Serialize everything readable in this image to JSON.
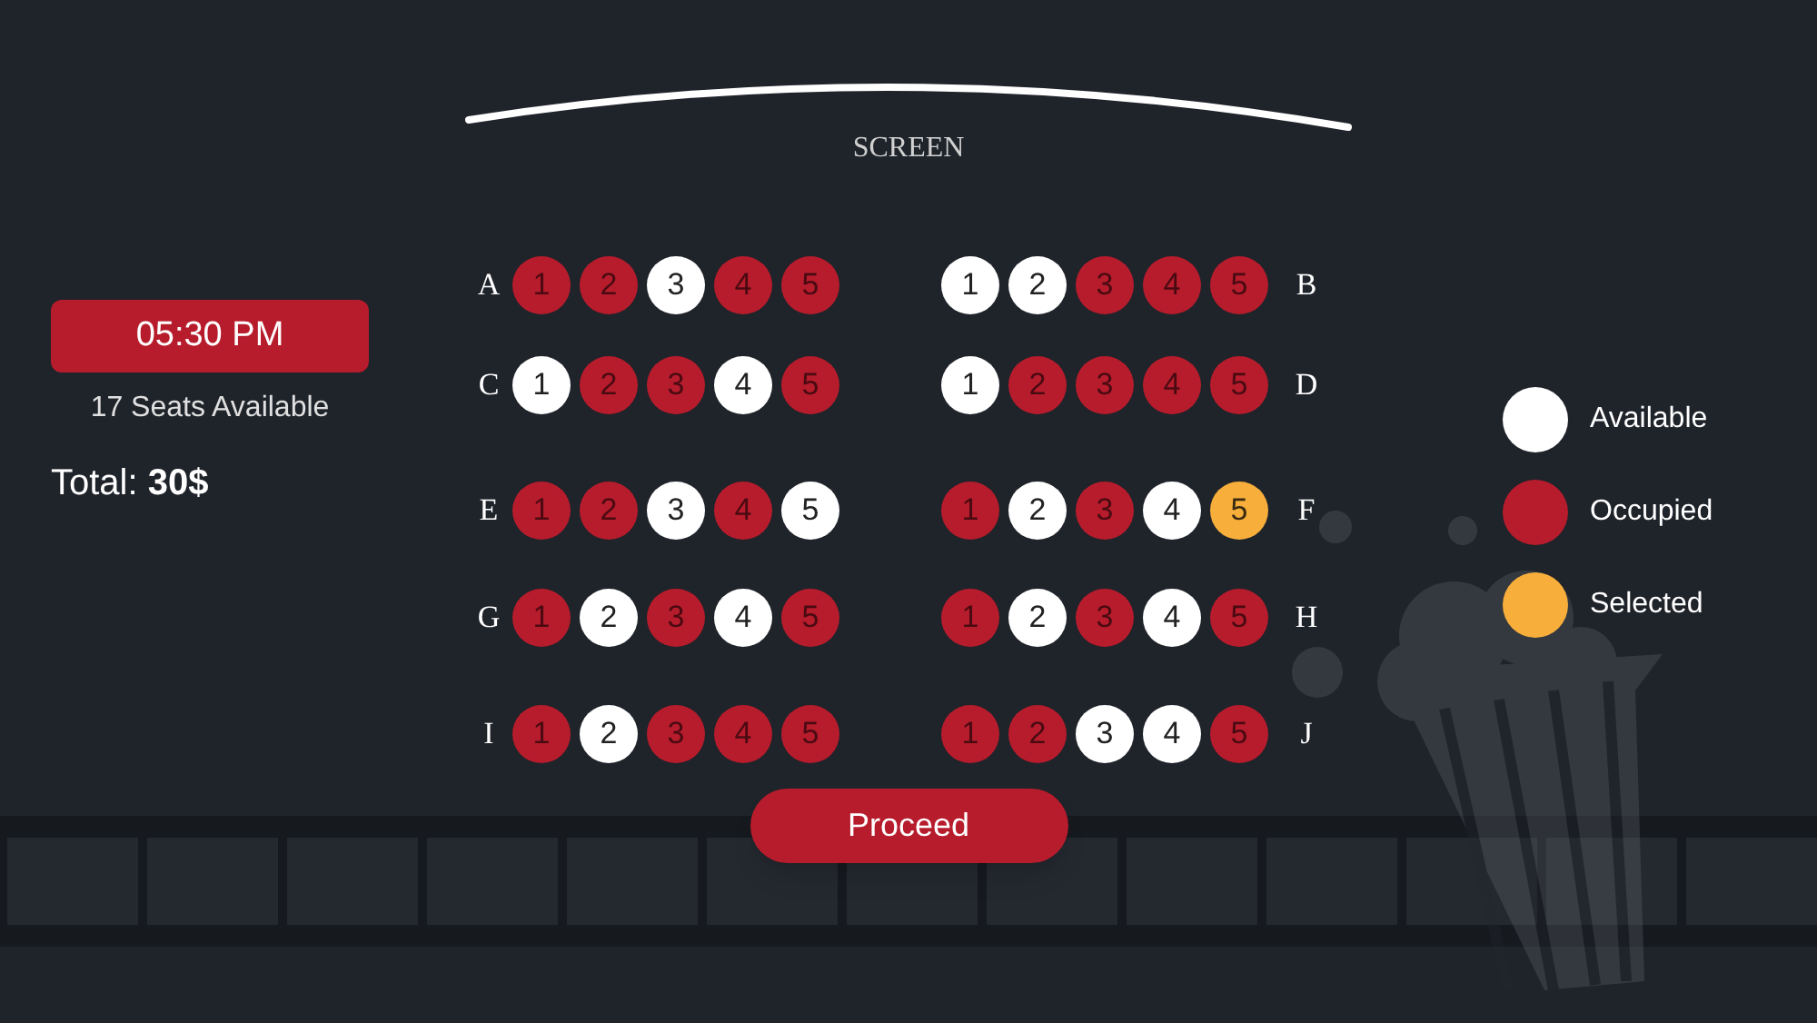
{
  "screen_label": "SCREEN",
  "showtime": {
    "time": "05:30 PM",
    "seats_available": "17 Seats Available",
    "total": "Total: **30$**"
  },
  "seat_rows": [
    {
      "blocks": [
        {
          "label": "A",
          "seats": [
            {
              "number": "1",
              "occupied": true,
              "selected": false
            },
            {
              "number": "2",
              "occupied": true,
              "selected": false
            },
            {
              "number": "3",
              "occupied": false,
              "selected": false
            },
            {
              "number": "4",
              "occupied": true,
              "selected": false
            },
            {
              "number": "5",
              "occupied": true,
              "selected": false
            }
          ]
        },
        {
          "label": "B",
          "seats": [
            {
              "number": "1",
              "occupied": false,
              "selected": false
            },
            {
              "number": "2",
              "occupied": false,
              "selected": false
            },
            {
              "number": "3",
              "occupied": true,
              "selected": false
            },
            {
              "number": "4",
              "occupied": true,
              "selected": false
            },
            {
              "number": "5",
              "occupied": true,
              "selected": false
            }
          ]
        }
      ]
    },
    {
      "blocks": [
        {
          "label": "C",
          "seats": [
            {
              "number": "1",
              "occupied": false,
              "selected": false
            },
            {
              "number": "2",
              "occupied": true,
              "selected": false
            },
            {
              "number": "3",
              "occupied": true,
              "selected": false
            },
            {
              "number": "4",
              "occupied": false,
              "selected": false
            },
            {
              "number": "5",
              "occupied": true,
              "selected": false
            }
          ]
        },
        {
          "label": "D",
          "seats": [
            {
              "number": "1",
              "occupied": false,
              "selected": false
            },
            {
              "number": "2",
              "occupied": true,
              "selected": false
            },
            {
              "number": "3",
              "occupied": true,
              "selected": false
            },
            {
              "number": "4",
              "occupied": true,
              "selected": false
            },
            {
              "number": "5",
              "occupied": true,
              "selected": false
            }
          ]
        }
      ]
    },
    {
      "blocks": [
        {
          "label": "E",
          "seats": [
            {
              "number": "1",
              "occupied": true,
              "selected": false
            },
            {
              "number": "2",
              "occupied": true,
              "selected": false
            },
            {
              "number": "3",
              "occupied": false,
              "selected": false
            },
            {
              "number": "4",
              "occupied": true,
              "selected": false
            },
            {
              "number": "5",
              "occupied": false,
              "selected": false
            }
          ]
        },
        {
          "label": "F",
          "seats": [
            {
              "number": "1",
              "occupied": true,
              "selected": false
            },
            {
              "number": "2",
              "occupied": false,
              "selected": false
            },
            {
              "number": "3",
              "occupied": true,
              "selected": false
            },
            {
              "number": "4",
              "occupied": false,
              "selected": false
            },
            {
              "number": "5",
              "occupied": false,
              "selected": true
            }
          ]
        }
      ]
    },
    {
      "blocks": [
        {
          "label": "G",
          "seats": [
            {
              "number": "1",
              "occupied": true,
              "selected": false
            },
            {
              "number": "2",
              "occupied": false,
              "selected": false
            },
            {
              "number": "3",
              "occupied": true,
              "selected": false
            },
            {
              "number": "4",
              "occupied": false,
              "selected": false
            },
            {
              "number": "5",
              "occupied": true,
              "selected": false
            }
          ]
        },
        {
          "label": "H",
          "seats": [
            {
              "number": "1",
              "occupied": true,
              "selected": false
            },
            {
              "number": "2",
              "occupied": false,
              "selected": false
            },
            {
              "number": "3",
              "occupied": true,
              "selected": false
            },
            {
              "number": "4",
              "occupied": false,
              "selected": false
            },
            {
              "number": "5",
              "occupied": true,
              "selected": false
            }
          ]
        }
      ]
    },
    {
      "blocks": [
        {
          "label": "I",
          "seats": [
            {
              "number": "1",
              "occupied": true,
              "selected": false
            },
            {
              "number": "2",
              "occupied": false,
              "selected": false
            },
            {
              "number": "3",
              "occupied": true,
              "selected": false
            },
            {
              "number": "4",
              "occupied": true,
              "selected": false
            },
            {
              "number": "5",
              "occupied": true,
              "selected": false
            }
          ]
        },
        {
          "label": "J",
          "seats": [
            {
              "number": "1",
              "occupied": true,
              "selected": false
            },
            {
              "number": "2",
              "occupied": true,
              "selected": false
            },
            {
              "number": "3",
              "occupied": false,
              "selected": false
            },
            {
              "number": "4",
              "occupied": false,
              "selected": false
            },
            {
              "number": "5",
              "occupied": true,
              "selected": false
            }
          ]
        }
      ]
    }
  ],
  "legend": [
    {
      "kind": "available",
      "label": "Available"
    },
    {
      "kind": "occupied",
      "label": "Occupied"
    },
    {
      "kind": "selected",
      "label": "Selected"
    }
  ],
  "proceed_button": "Proceed"
}
